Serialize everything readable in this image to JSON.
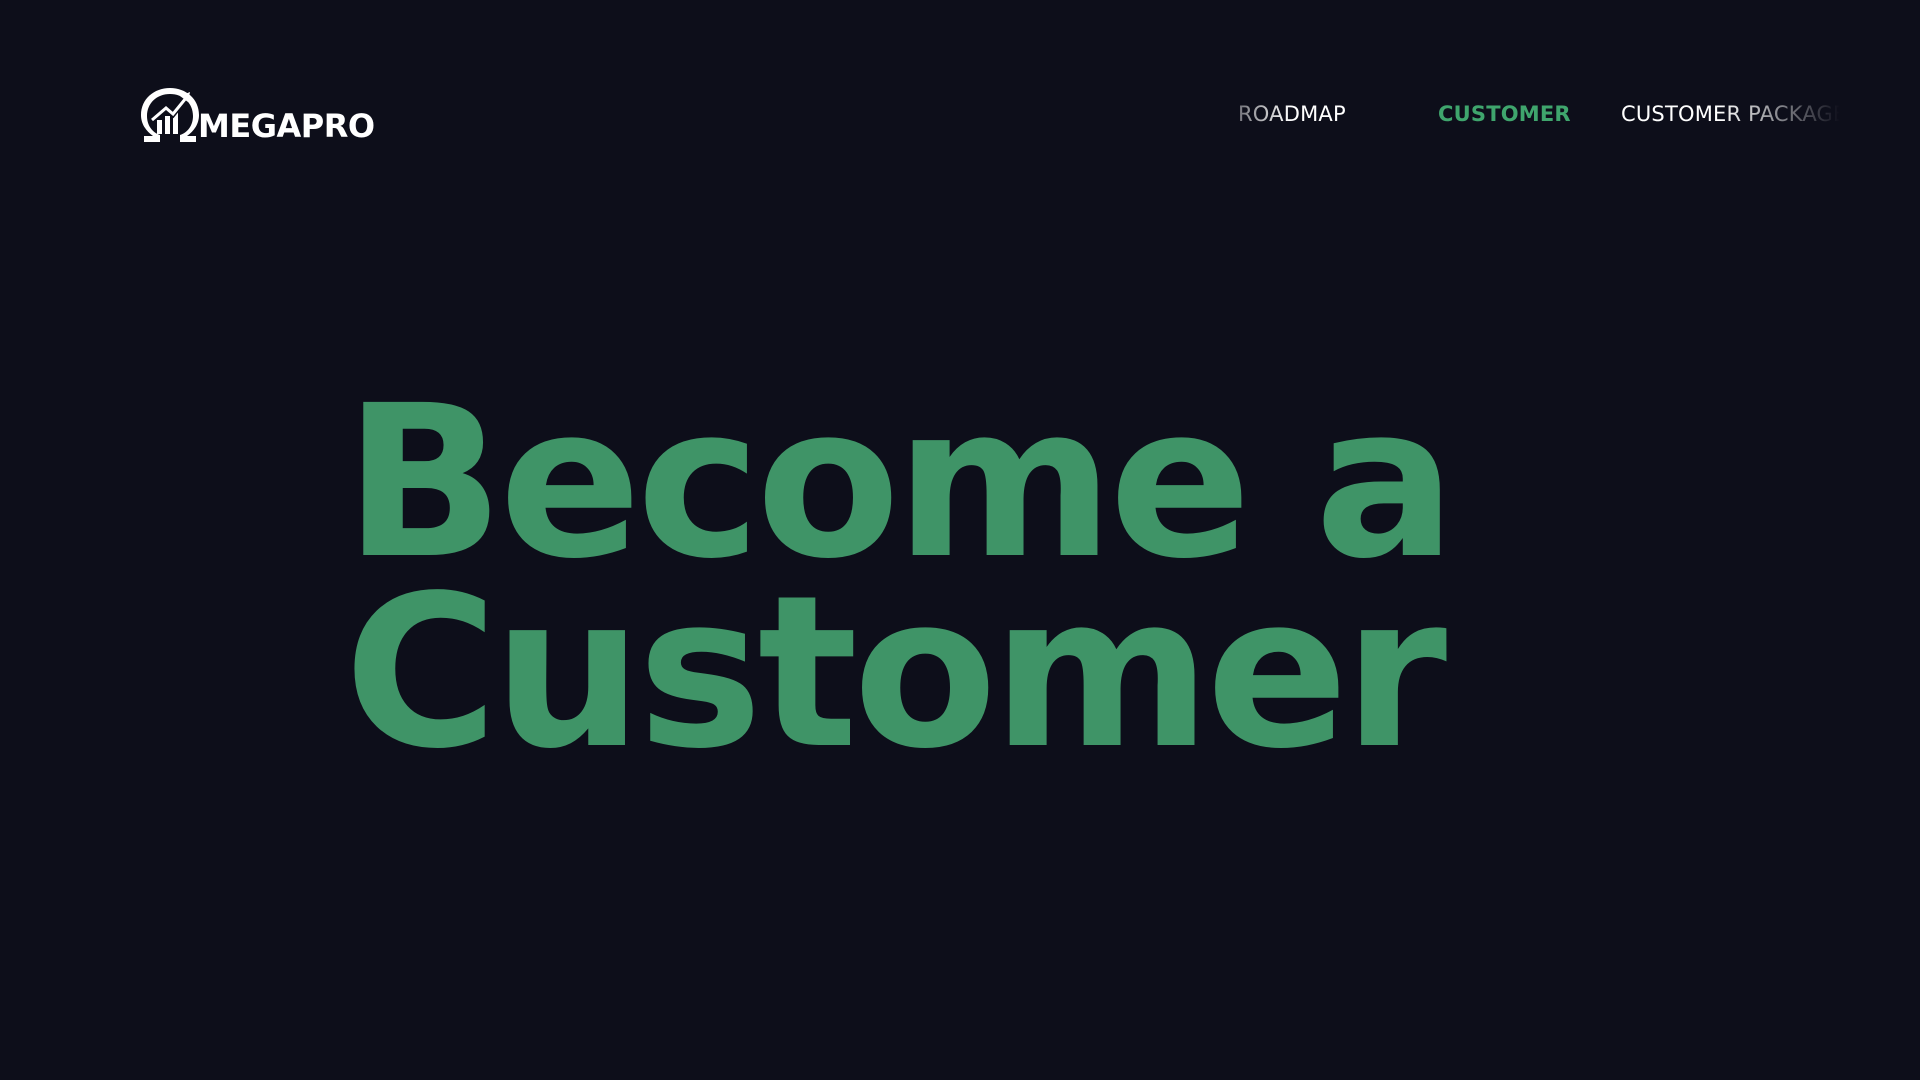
{
  "brand": {
    "name": "MEGAPRO",
    "logo_icon": "omega-growth-chart-icon"
  },
  "nav": {
    "items": [
      {
        "label": "ROADMAP",
        "active": false
      },
      {
        "label": "CUSTOMER",
        "active": true
      },
      {
        "label": "CUSTOMER PACKAGE",
        "active": false
      }
    ]
  },
  "hero": {
    "line1": "Become a",
    "line2": "Customer"
  },
  "colors": {
    "background": "#0d0e1a",
    "accent": "#3fa56d",
    "hero_text": "#3f9467",
    "text": "#ffffff"
  }
}
